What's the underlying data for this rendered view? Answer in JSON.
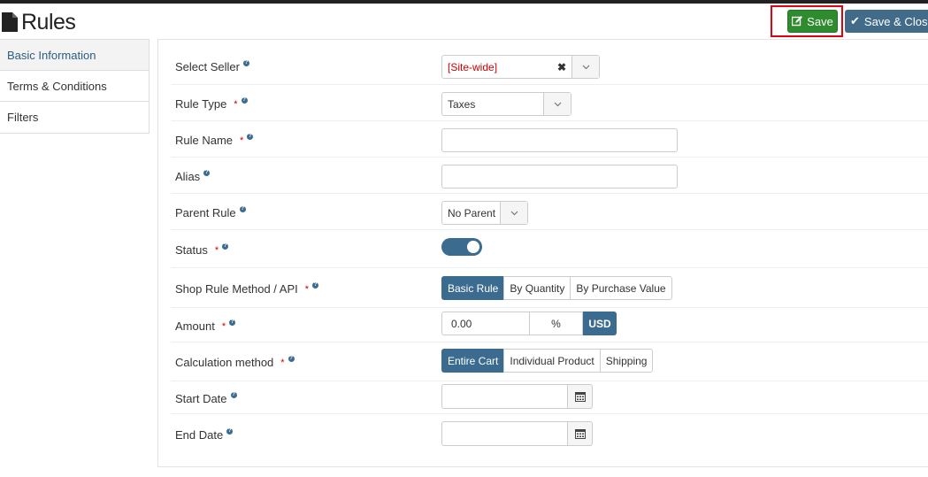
{
  "page": {
    "title": "Rules"
  },
  "toolbar": {
    "save_label": "Save",
    "save_close_label": "Save & Close"
  },
  "tabs": [
    {
      "label": "Basic Information",
      "active": true
    },
    {
      "label": "Terms & Conditions",
      "active": false
    },
    {
      "label": "Filters",
      "active": false
    }
  ],
  "form": {
    "select_seller": {
      "label": "Select Seller",
      "value": "[Site-wide]"
    },
    "rule_type": {
      "label": "Rule Type",
      "required": "*",
      "value": "Taxes"
    },
    "rule_name": {
      "label": "Rule Name",
      "required": "*",
      "value": ""
    },
    "alias": {
      "label": "Alias",
      "value": ""
    },
    "parent_rule": {
      "label": "Parent Rule",
      "value": "No Parent"
    },
    "status": {
      "label": "Status",
      "required": "*",
      "enabled": true
    },
    "method": {
      "label": "Shop Rule Method / API",
      "required": "*",
      "options": [
        "Basic Rule",
        "By Quantity",
        "By Purchase Value"
      ],
      "selected": "Basic Rule"
    },
    "amount": {
      "label": "Amount",
      "required": "*",
      "value": "0.00",
      "percent": "%",
      "currency": "USD"
    },
    "calculation": {
      "label": "Calculation method",
      "required": "*",
      "options": [
        "Entire Cart",
        "Individual Product",
        "Shipping"
      ],
      "selected": "Entire Cart"
    },
    "start_date": {
      "label": "Start Date",
      "value": ""
    },
    "end_date": {
      "label": "End Date",
      "value": ""
    }
  },
  "colors": {
    "accent": "#3b6b8f",
    "save": "#2e8b2e",
    "required": "#cc0000",
    "highlight": "#e3000f"
  }
}
